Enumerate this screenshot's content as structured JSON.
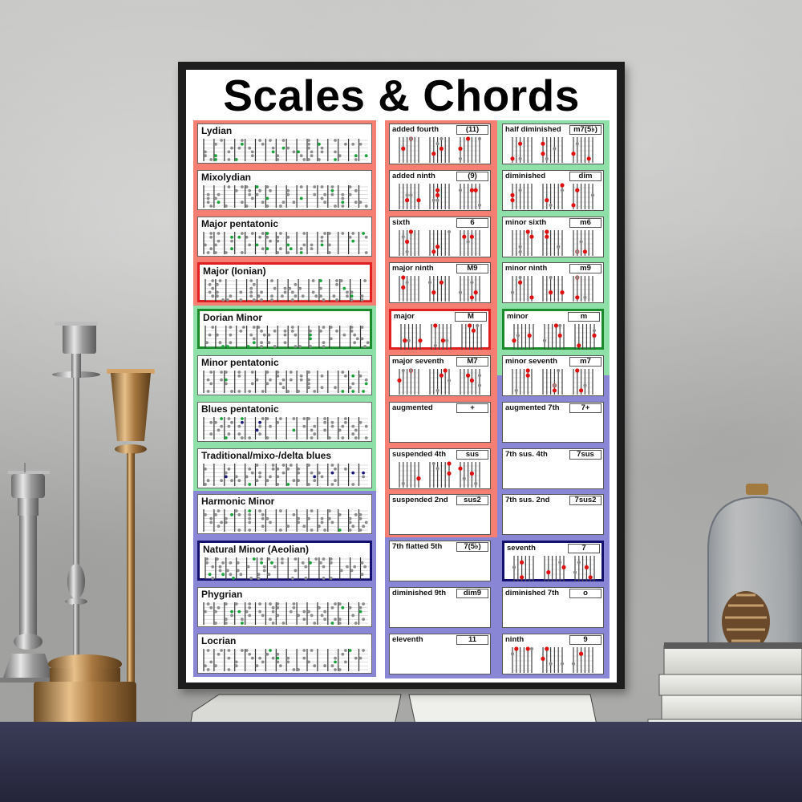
{
  "poster": {
    "title": "Scales & Chords",
    "colors": {
      "salmon": "#f47f72",
      "mint": "#8ee0a8",
      "lavender": "#8a86d6",
      "red_highlight": "#e02020",
      "green_highlight": "#1a8a2a",
      "navy_highlight": "#141070",
      "dot_root_scale": "#1aa33a",
      "dot_blue_note": "#1a1a7a",
      "dot_root_chord": "#e01010",
      "dot_other": "#8c8c8c"
    },
    "scales": [
      {
        "name": "Lydian",
        "group": "salmon",
        "highlight": "none",
        "has_blue_notes": false
      },
      {
        "name": "Mixolydian",
        "group": "salmon",
        "highlight": "none",
        "has_blue_notes": false
      },
      {
        "name": "Major pentatonic",
        "group": "salmon",
        "highlight": "none",
        "has_blue_notes": false
      },
      {
        "name": "Major (Ionian)",
        "group": "salmon",
        "highlight": "red",
        "has_blue_notes": false
      },
      {
        "name": "Dorian Minor",
        "group": "mint",
        "highlight": "green",
        "has_blue_notes": false
      },
      {
        "name": "Minor pentatonic",
        "group": "mint",
        "highlight": "none",
        "has_blue_notes": false
      },
      {
        "name": "Blues pentatonic",
        "group": "mint",
        "highlight": "none",
        "has_blue_notes": true
      },
      {
        "name": "Traditional/mixo-/delta blues",
        "group": "mint",
        "highlight": "none",
        "has_blue_notes": true
      },
      {
        "name": "Harmonic Minor",
        "group": "lavender",
        "highlight": "none",
        "has_blue_notes": false
      },
      {
        "name": "Natural Minor (Aeolian)",
        "group": "lavender",
        "highlight": "navy",
        "has_blue_notes": false
      },
      {
        "name": "Phygrian",
        "group": "lavender",
        "highlight": "none",
        "has_blue_notes": false
      },
      {
        "name": "Locrian",
        "group": "lavender",
        "highlight": "none",
        "has_blue_notes": false
      }
    ],
    "chords_left": [
      {
        "name": "added fourth",
        "symbol": "(11)",
        "has_diagrams": true,
        "highlight": "none"
      },
      {
        "name": "added ninth",
        "symbol": "(9)",
        "has_diagrams": true,
        "highlight": "none"
      },
      {
        "name": "sixth",
        "symbol": "6",
        "has_diagrams": true,
        "highlight": "none"
      },
      {
        "name": "major ninth",
        "symbol": "M9",
        "has_diagrams": true,
        "highlight": "none"
      },
      {
        "name": "major",
        "symbol": "M",
        "has_diagrams": true,
        "highlight": "red"
      },
      {
        "name": "major seventh",
        "symbol": "M7",
        "has_diagrams": true,
        "highlight": "none"
      },
      {
        "name": "augmented",
        "symbol": "+",
        "has_diagrams": false,
        "highlight": "none"
      },
      {
        "name": "suspended 4th",
        "symbol": "sus",
        "has_diagrams": true,
        "highlight": "none"
      },
      {
        "name": "suspended 2nd",
        "symbol": "sus2",
        "has_diagrams": false,
        "highlight": "none"
      },
      {
        "name": "7th flatted 5th",
        "symbol": "7(5♭)",
        "has_diagrams": false,
        "highlight": "none"
      },
      {
        "name": "diminished 9th",
        "symbol": "dim9",
        "has_diagrams": false,
        "highlight": "none"
      },
      {
        "name": "eleventh",
        "symbol": "11",
        "has_diagrams": false,
        "highlight": "none"
      }
    ],
    "chords_right": [
      {
        "name": "half diminished",
        "symbol": "m7(5♭)",
        "has_diagrams": true,
        "highlight": "none"
      },
      {
        "name": "diminished",
        "symbol": "dim",
        "has_diagrams": true,
        "highlight": "none"
      },
      {
        "name": "minor sixth",
        "symbol": "m6",
        "has_diagrams": true,
        "highlight": "none"
      },
      {
        "name": "minor ninth",
        "symbol": "m9",
        "has_diagrams": true,
        "highlight": "none"
      },
      {
        "name": "minor",
        "symbol": "m",
        "has_diagrams": true,
        "highlight": "green"
      },
      {
        "name": "minor seventh",
        "symbol": "m7",
        "has_diagrams": true,
        "highlight": "none"
      },
      {
        "name": "augmented 7th",
        "symbol": "7+",
        "has_diagrams": false,
        "highlight": "none"
      },
      {
        "name": "7th sus. 4th",
        "symbol": "7sus",
        "has_diagrams": false,
        "highlight": "none"
      },
      {
        "name": "7th sus. 2nd",
        "symbol": "7sus2",
        "has_diagrams": false,
        "highlight": "none"
      },
      {
        "name": "seventh",
        "symbol": "7",
        "has_diagrams": true,
        "highlight": "navy"
      },
      {
        "name": "diminished 7th",
        "symbol": "o",
        "has_diagrams": false,
        "highlight": "none"
      },
      {
        "name": "ninth",
        "symbol": "9",
        "has_diagrams": true,
        "highlight": "none"
      }
    ]
  },
  "scene": {
    "objects": [
      "silver candlestick (short)",
      "silver candlestick (tall)",
      "brass candlestick",
      "brass box",
      "glass cloche with pine cone",
      "stack of books (right)",
      "books under poster"
    ]
  }
}
